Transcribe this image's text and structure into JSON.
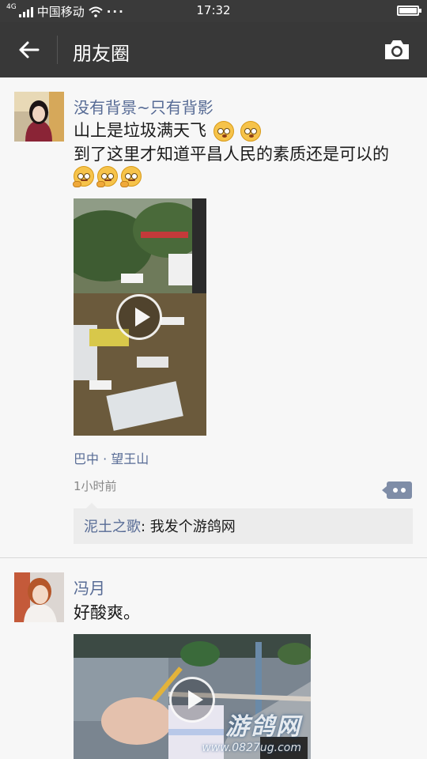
{
  "status_bar": {
    "network_label": "4G",
    "carrier": "中国移动",
    "more_indicator": "···",
    "time": "17:32",
    "battery_level": 0.9
  },
  "nav": {
    "back_icon": "arrow-left-icon",
    "title": "朋友圈",
    "camera_icon": "camera-icon"
  },
  "posts": [
    {
      "username": "没有背景~只有背影",
      "text_line1": "山上是垃圾满天飞",
      "text_line2": "到了这里才知道平昌人民的素质还是可以的",
      "line1_emojis": [
        "flushed-emoji",
        "flushed-emoji"
      ],
      "line3_emojis": [
        "thinking-emoji",
        "thinking-emoji",
        "thinking-emoji"
      ],
      "media_type": "video",
      "location": "巴中 · 望王山",
      "time": "1小时前",
      "comments": [
        {
          "author": "泥土之歌",
          "separator": ": ",
          "text": "我发个游鸽网"
        }
      ]
    },
    {
      "username": "冯月",
      "text_line1": "好酸爽。",
      "media_type": "video",
      "watermark": {
        "main": "游鸽网",
        "url": "www.0827ug.com"
      }
    }
  ],
  "colors": {
    "nav_background": "#383838",
    "status_background": "#3a3a3a",
    "link_blue": "#576b95",
    "feed_background": "#f7f7f7",
    "comment_box": "#ececec"
  }
}
